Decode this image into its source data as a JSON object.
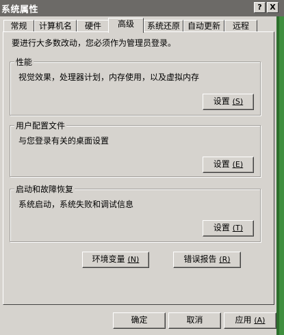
{
  "window": {
    "title": "系统属性",
    "help_button": "?",
    "close_button": "X"
  },
  "tabs": [
    {
      "label": "常规"
    },
    {
      "label": "计算机名"
    },
    {
      "label": "硬件"
    },
    {
      "label": "高级"
    },
    {
      "label": "系统还原"
    },
    {
      "label": "自动更新"
    },
    {
      "label": "远程"
    }
  ],
  "main": {
    "intro": "要进行大多数改动，您必须作为管理员登录。",
    "performance": {
      "label": "性能",
      "description": "视觉效果，处理器计划，内存使用，以及虚拟内存",
      "button": "设置",
      "accel": "(S)"
    },
    "user_profiles": {
      "label": "用户配置文件",
      "description": "与您登录有关的桌面设置",
      "button": "设置",
      "accel": "(E)"
    },
    "startup_recovery": {
      "label": "启动和故障恢复",
      "description": "系统启动，系统失败和调试信息",
      "button": "设置",
      "accel": "(T)"
    },
    "env_button": {
      "label": "环境变量",
      "accel": "(N)"
    },
    "error_button": {
      "label": "错误报告",
      "accel": "(R)"
    }
  },
  "footer": {
    "ok": "确定",
    "cancel": "取消",
    "apply": "应用",
    "apply_accel": "(A)"
  }
}
